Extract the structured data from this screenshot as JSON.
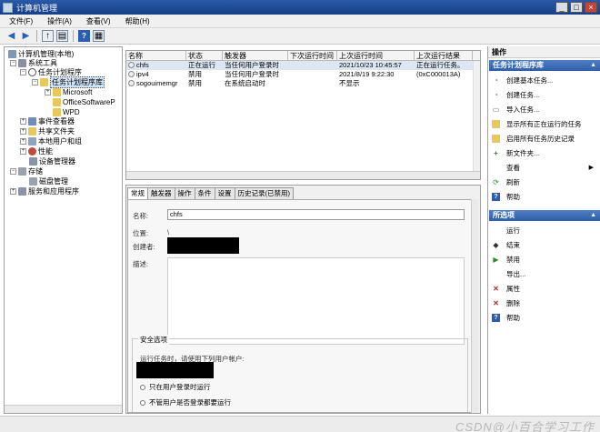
{
  "window": {
    "title": "计算机管理"
  },
  "menu": [
    "文件(F)",
    "操作(A)",
    "查看(V)",
    "帮助(H)"
  ],
  "colors": {
    "titlebar": "#1f4d9b",
    "section_header": "#3a6bb6",
    "selected_row": "#dde6f2"
  },
  "tree": [
    {
      "label": "计算机管理(本地)"
    },
    {
      "label": "系统工具"
    },
    {
      "label": "任务计划程序"
    },
    {
      "label": "任务计划程序库"
    },
    {
      "label": "Microsoft"
    },
    {
      "label": "OfficeSoftwareP"
    },
    {
      "label": "WPD"
    },
    {
      "label": "事件查看器"
    },
    {
      "label": "共享文件夹"
    },
    {
      "label": "本地用户和组"
    },
    {
      "label": "性能"
    },
    {
      "label": "设备管理器"
    },
    {
      "label": "存储"
    },
    {
      "label": "磁盘管理"
    },
    {
      "label": "服务和应用程序"
    }
  ],
  "list": {
    "columns": [
      "名称",
      "状态",
      "触发器",
      "下次运行时间",
      "上次运行时间",
      "上次运行结果"
    ],
    "rows": [
      {
        "name": "chfs",
        "status": "正在运行",
        "trigger": "当任何用户登录时",
        "next": "",
        "last": "2021/10/23 10:45:57",
        "result": "正在运行任务。"
      },
      {
        "name": "ipv4",
        "status": "禁用",
        "trigger": "当任何用户登录时",
        "next": "",
        "last": "2021/8/19 9:22:30",
        "result": "(0xC000013A)"
      },
      {
        "name": "sogouimemgr",
        "status": "禁用",
        "trigger": "在系统启动时",
        "next": "",
        "last": "不显示",
        "result": ""
      }
    ]
  },
  "detail": {
    "tabs": [
      "常规",
      "触发器",
      "操作",
      "条件",
      "设置",
      "历史记录(已禁用)"
    ],
    "name_label": "名称:",
    "name_value": "chfs",
    "location_label": "位置:",
    "location_value": "\\",
    "author_label": "创建者:",
    "desc_label": "描述:",
    "security_legend": "安全选项",
    "run_as_text": "运行任务时，请使用下列用户帐户:",
    "radio_1": "只在用户登录时运行",
    "radio_2": "不管用户是否登录都要运行"
  },
  "actions": {
    "header": "操作",
    "section1": "任务计划程序库",
    "items1": [
      "创建基本任务...",
      "创建任务...",
      "导入任务...",
      "显示所有正在运行的任务",
      "启用所有任务历史记录",
      "新文件夹...",
      "查看",
      "刷新",
      "帮助"
    ],
    "section2": "所选项",
    "items2": [
      "运行",
      "结束",
      "禁用",
      "导出...",
      "属性",
      "删除",
      "帮助"
    ]
  },
  "watermark": "CSDN@小百合学习工作"
}
